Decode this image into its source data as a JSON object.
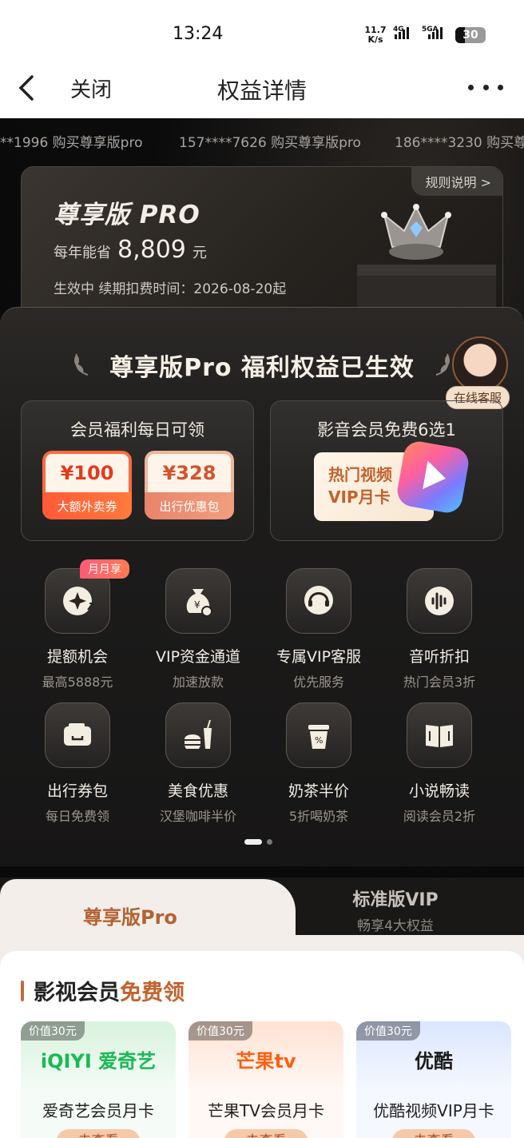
{
  "status_bar": {
    "time": "13:24",
    "net_speed": "11.7\nK/s",
    "sig1": "4G",
    "sig2": "5GA",
    "battery": "30"
  },
  "nav": {
    "close_label": "关闭",
    "title": "权益详情"
  },
  "ticker": [
    "**1996 购买尊享版pro",
    "157****7626 购买尊享版pro",
    "186****3230 购买尊"
  ],
  "pro_card": {
    "rule_label": "规则说明 >",
    "title": "尊享版 PRO",
    "save_prefix": "每年能省",
    "save_amount": "8,809",
    "save_unit": "元",
    "status": "生效中 续期扣费时间：2026-08-20起"
  },
  "benefit_panel": {
    "title": "尊享版Pro 福利权益已生效",
    "customer_service": "在线客服",
    "daily_box": {
      "title": "会员福利每日可领",
      "coupons": [
        {
          "amount": "¥100",
          "label": "大额外卖券"
        },
        {
          "amount": "¥328",
          "label": "出行优惠包"
        }
      ]
    },
    "media_box": {
      "title": "影音会员免费6选1",
      "card_line1": "热门视频",
      "card_line2": "VIP月卡"
    },
    "badge": "月月享",
    "items": [
      {
        "label": "提额机会",
        "sub": "最高5888元",
        "icon": "sparkle-arrow-icon"
      },
      {
        "label": "VIP资金通道",
        "sub": "加速放款",
        "icon": "money-bag-icon"
      },
      {
        "label": "专属VIP客服",
        "sub": "优先服务",
        "icon": "headset-icon"
      },
      {
        "label": "音听折扣",
        "sub": "热门会员3折",
        "icon": "sound-wave-icon"
      },
      {
        "label": "出行券包",
        "sub": "每日免费领",
        "icon": "ticket-icon"
      },
      {
        "label": "美食优惠",
        "sub": "汉堡咖啡半价",
        "icon": "burger-drink-icon"
      },
      {
        "label": "奶茶半价",
        "sub": "5折喝奶茶",
        "icon": "milk-tea-icon"
      },
      {
        "label": "小说畅读",
        "sub": "阅读会员2折",
        "icon": "book-icon"
      }
    ]
  },
  "tabs": {
    "active": "尊享版Pro",
    "standard_title": "标准版VIP",
    "standard_sub": "畅享4大权益"
  },
  "video_section": {
    "title_prefix": "影视会员",
    "title_highlight": "免费领",
    "cards": [
      {
        "worth": "价值30元",
        "logo": "iQIYI 爱奇艺",
        "name": "爱奇艺会员月卡",
        "action": "去查看"
      },
      {
        "worth": "价值30元",
        "logo": "芒果tv",
        "name": "芒果TV会员月卡",
        "action": "去查看"
      },
      {
        "worth": "价值30元",
        "logo": "优酷",
        "name": "优酷视频VIP月卡",
        "action": "去查看"
      }
    ]
  },
  "colors": {
    "accent": "#c2622e",
    "dark_bg": "#0b0b0c",
    "coupon_red": "#ff5a36"
  }
}
